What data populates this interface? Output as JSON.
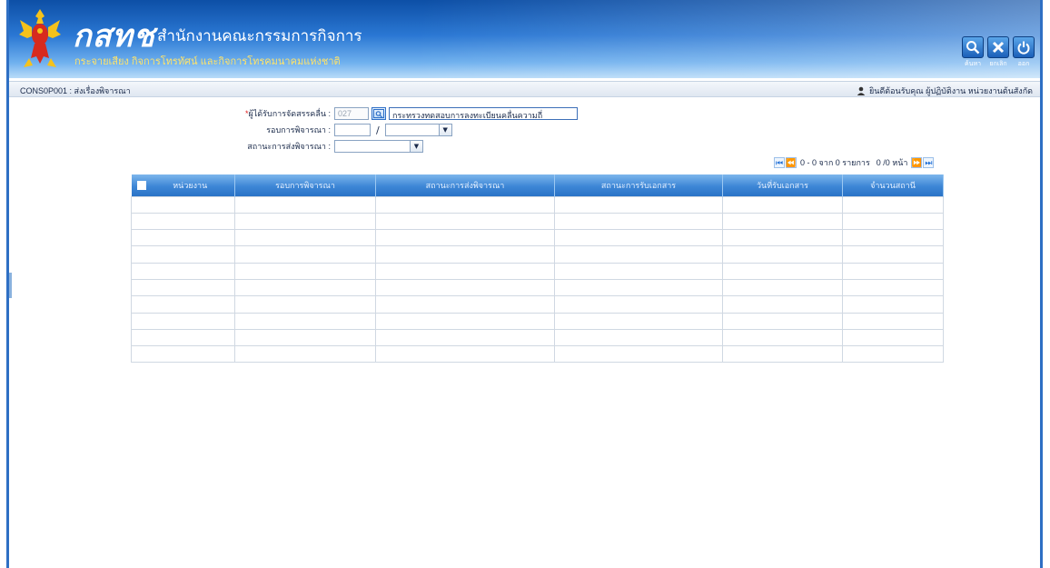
{
  "header": {
    "logo": "กสทช",
    "org_name": "สำนักงานคณะกรรมการกิจการ",
    "org_sub": "กระจายเสียง กิจการโทรทัศน์ และกิจการโทรคมนาคมแห่งชาติ",
    "colors": {
      "banner_dark": "#0d4fa6",
      "banner_light": "#b9dcf8",
      "sub_text": "#ffe36a"
    },
    "tools": [
      {
        "icon": "search-icon",
        "label": "ค้นหา"
      },
      {
        "icon": "close-icon",
        "label": "ยกเลิก"
      },
      {
        "icon": "power-icon",
        "label": "ออก"
      }
    ]
  },
  "titlebar": {
    "page_code": "CONS0P001 : ส่งเรื่องพิจารณา",
    "welcome": "ยินดีต้อนรับคุณ ผู้ปฏิบัติงาน หน่วยงานต้นสังกัด"
  },
  "form": {
    "allocatee_label": "ผู้ได้รับการจัดสรรคลื่น :",
    "allocatee_required": "*",
    "allocatee_code": "027",
    "allocatee_name": "กระทรวงทดสอบการลงทะเบียนคลื่นความถี่",
    "round_label": "รอบการพิจารณา :",
    "round_value": "",
    "round_separator": "/",
    "round_year": "",
    "status_label": "สถานะการส่งพิจารณา :",
    "status_value": ""
  },
  "pager": {
    "text": "0 - 0 จาก 0 รายการ",
    "page_text": "0 /0 หน้า"
  },
  "table": {
    "columns": [
      "หน่วยงาน",
      "รอบการพิจารณา",
      "สถานะการส่งพิจารณา",
      "สถานะการรับเอกสาร",
      "วันที่รับเอกสาร",
      "จำนวนสถานี"
    ]
  }
}
